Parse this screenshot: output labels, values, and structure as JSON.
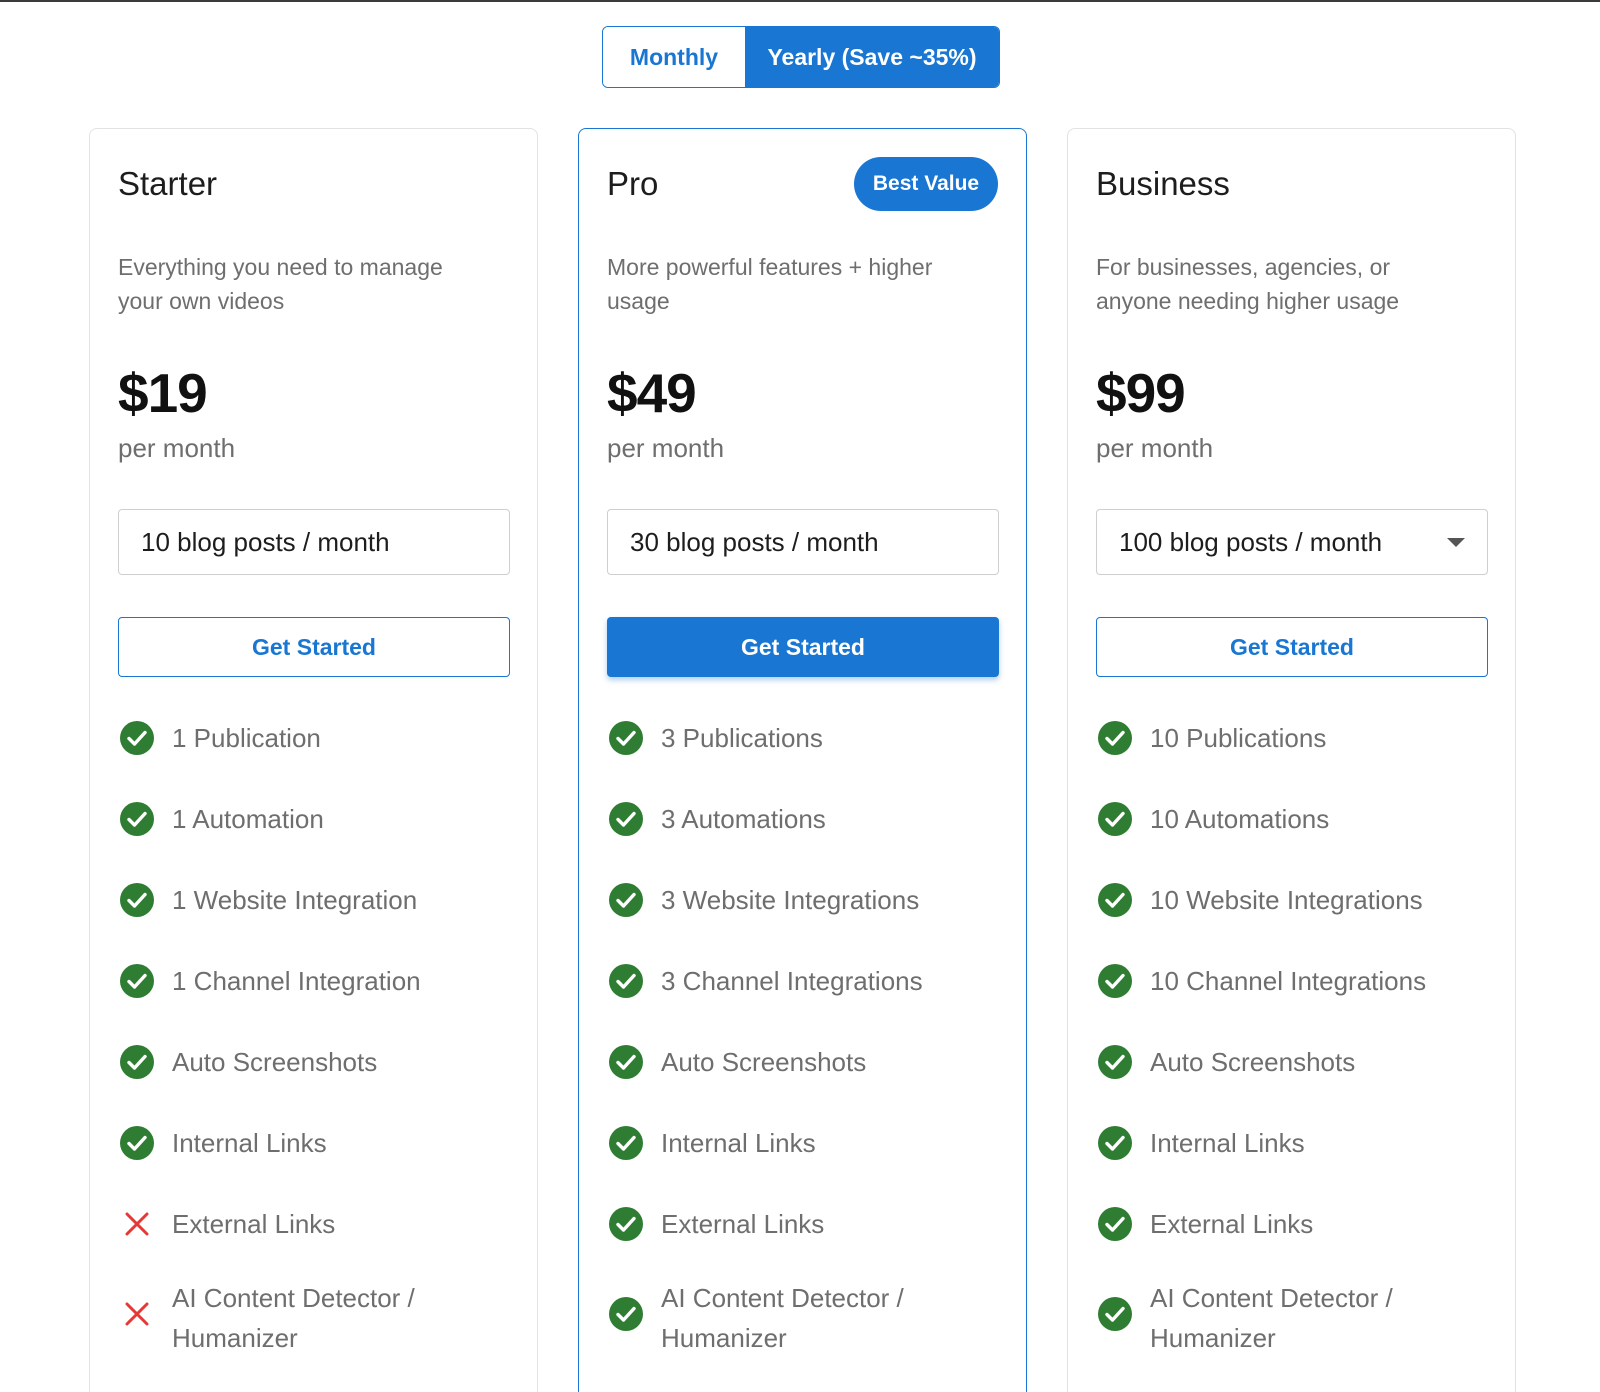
{
  "billing_toggle": {
    "monthly": "Monthly",
    "yearly": "Yearly (Save ~35%)",
    "selected": "yearly"
  },
  "colors": {
    "accent": "#1976d2",
    "check": "#2e7d32",
    "cross": "#e53935"
  },
  "plans": [
    {
      "name": "Starter",
      "description": "Everything you need to manage your own videos",
      "price": "$19",
      "period": "per month",
      "select_value": "10 blog posts / month",
      "cta": "Get Started",
      "features": [
        {
          "label": "1 Publication",
          "included": true
        },
        {
          "label": "1 Automation",
          "included": true
        },
        {
          "label": "1 Website Integration",
          "included": true
        },
        {
          "label": "1 Channel Integration",
          "included": true
        },
        {
          "label": "Auto Screenshots",
          "included": true
        },
        {
          "label": "Internal Links",
          "included": true
        },
        {
          "label": "External Links",
          "included": false
        },
        {
          "label": "AI Content Detector / Humanizer",
          "included": false
        }
      ]
    },
    {
      "name": "Pro",
      "badge": "Best Value",
      "description": "More powerful features + higher usage",
      "price": "$49",
      "period": "per month",
      "select_value": "30 blog posts / month",
      "cta": "Get Started",
      "features": [
        {
          "label": "3 Publications",
          "included": true
        },
        {
          "label": "3 Automations",
          "included": true
        },
        {
          "label": "3 Website Integrations",
          "included": true
        },
        {
          "label": "3 Channel Integrations",
          "included": true
        },
        {
          "label": "Auto Screenshots",
          "included": true
        },
        {
          "label": "Internal Links",
          "included": true
        },
        {
          "label": "External Links",
          "included": true
        },
        {
          "label": "AI Content Detector / Humanizer",
          "included": true
        }
      ]
    },
    {
      "name": "Business",
      "description": "For businesses, agencies, or anyone needing higher usage",
      "price": "$99",
      "period": "per month",
      "select_value": "100 blog posts / month",
      "cta": "Get Started",
      "features": [
        {
          "label": "10 Publications",
          "included": true
        },
        {
          "label": "10 Automations",
          "included": true
        },
        {
          "label": "10 Website Integrations",
          "included": true
        },
        {
          "label": "10 Channel Integrations",
          "included": true
        },
        {
          "label": "Auto Screenshots",
          "included": true
        },
        {
          "label": "Internal Links",
          "included": true
        },
        {
          "label": "External Links",
          "included": true
        },
        {
          "label": "AI Content Detector / Humanizer",
          "included": true
        }
      ]
    }
  ]
}
